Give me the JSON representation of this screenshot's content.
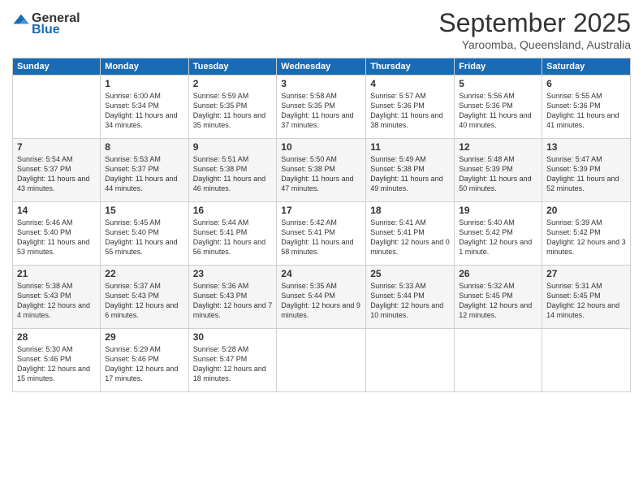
{
  "logo": {
    "general": "General",
    "blue": "Blue"
  },
  "header": {
    "month": "September 2025",
    "location": "Yaroomba, Queensland, Australia"
  },
  "days_of_week": [
    "Sunday",
    "Monday",
    "Tuesday",
    "Wednesday",
    "Thursday",
    "Friday",
    "Saturday"
  ],
  "weeks": [
    [
      null,
      {
        "day": "1",
        "sunrise": "6:00 AM",
        "sunset": "5:34 PM",
        "daylight": "11 hours and 34 minutes."
      },
      {
        "day": "2",
        "sunrise": "5:59 AM",
        "sunset": "5:35 PM",
        "daylight": "11 hours and 35 minutes."
      },
      {
        "day": "3",
        "sunrise": "5:58 AM",
        "sunset": "5:35 PM",
        "daylight": "11 hours and 37 minutes."
      },
      {
        "day": "4",
        "sunrise": "5:57 AM",
        "sunset": "5:36 PM",
        "daylight": "11 hours and 38 minutes."
      },
      {
        "day": "5",
        "sunrise": "5:56 AM",
        "sunset": "5:36 PM",
        "daylight": "11 hours and 40 minutes."
      },
      {
        "day": "6",
        "sunrise": "5:55 AM",
        "sunset": "5:36 PM",
        "daylight": "11 hours and 41 minutes."
      }
    ],
    [
      {
        "day": "7",
        "sunrise": "5:54 AM",
        "sunset": "5:37 PM",
        "daylight": "11 hours and 43 minutes."
      },
      {
        "day": "8",
        "sunrise": "5:53 AM",
        "sunset": "5:37 PM",
        "daylight": "11 hours and 44 minutes."
      },
      {
        "day": "9",
        "sunrise": "5:51 AM",
        "sunset": "5:38 PM",
        "daylight": "11 hours and 46 minutes."
      },
      {
        "day": "10",
        "sunrise": "5:50 AM",
        "sunset": "5:38 PM",
        "daylight": "11 hours and 47 minutes."
      },
      {
        "day": "11",
        "sunrise": "5:49 AM",
        "sunset": "5:38 PM",
        "daylight": "11 hours and 49 minutes."
      },
      {
        "day": "12",
        "sunrise": "5:48 AM",
        "sunset": "5:39 PM",
        "daylight": "11 hours and 50 minutes."
      },
      {
        "day": "13",
        "sunrise": "5:47 AM",
        "sunset": "5:39 PM",
        "daylight": "11 hours and 52 minutes."
      }
    ],
    [
      {
        "day": "14",
        "sunrise": "5:46 AM",
        "sunset": "5:40 PM",
        "daylight": "11 hours and 53 minutes."
      },
      {
        "day": "15",
        "sunrise": "5:45 AM",
        "sunset": "5:40 PM",
        "daylight": "11 hours and 55 minutes."
      },
      {
        "day": "16",
        "sunrise": "5:44 AM",
        "sunset": "5:41 PM",
        "daylight": "11 hours and 56 minutes."
      },
      {
        "day": "17",
        "sunrise": "5:42 AM",
        "sunset": "5:41 PM",
        "daylight": "11 hours and 58 minutes."
      },
      {
        "day": "18",
        "sunrise": "5:41 AM",
        "sunset": "5:41 PM",
        "daylight": "12 hours and 0 minutes."
      },
      {
        "day": "19",
        "sunrise": "5:40 AM",
        "sunset": "5:42 PM",
        "daylight": "12 hours and 1 minute."
      },
      {
        "day": "20",
        "sunrise": "5:39 AM",
        "sunset": "5:42 PM",
        "daylight": "12 hours and 3 minutes."
      }
    ],
    [
      {
        "day": "21",
        "sunrise": "5:38 AM",
        "sunset": "5:43 PM",
        "daylight": "12 hours and 4 minutes."
      },
      {
        "day": "22",
        "sunrise": "5:37 AM",
        "sunset": "5:43 PM",
        "daylight": "12 hours and 6 minutes."
      },
      {
        "day": "23",
        "sunrise": "5:36 AM",
        "sunset": "5:43 PM",
        "daylight": "12 hours and 7 minutes."
      },
      {
        "day": "24",
        "sunrise": "5:35 AM",
        "sunset": "5:44 PM",
        "daylight": "12 hours and 9 minutes."
      },
      {
        "day": "25",
        "sunrise": "5:33 AM",
        "sunset": "5:44 PM",
        "daylight": "12 hours and 10 minutes."
      },
      {
        "day": "26",
        "sunrise": "5:32 AM",
        "sunset": "5:45 PM",
        "daylight": "12 hours and 12 minutes."
      },
      {
        "day": "27",
        "sunrise": "5:31 AM",
        "sunset": "5:45 PM",
        "daylight": "12 hours and 14 minutes."
      }
    ],
    [
      {
        "day": "28",
        "sunrise": "5:30 AM",
        "sunset": "5:46 PM",
        "daylight": "12 hours and 15 minutes."
      },
      {
        "day": "29",
        "sunrise": "5:29 AM",
        "sunset": "5:46 PM",
        "daylight": "12 hours and 17 minutes."
      },
      {
        "day": "30",
        "sunrise": "5:28 AM",
        "sunset": "5:47 PM",
        "daylight": "12 hours and 18 minutes."
      },
      null,
      null,
      null,
      null
    ]
  ]
}
